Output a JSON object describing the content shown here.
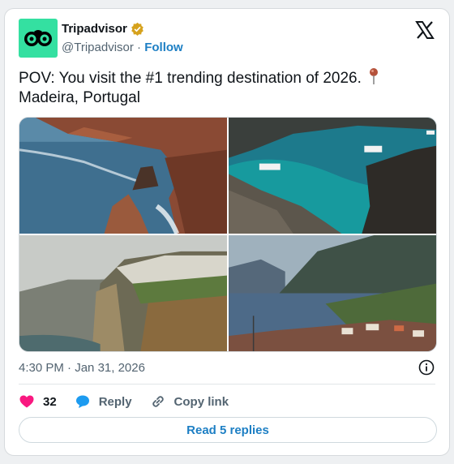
{
  "author": {
    "name": "Tripadvisor",
    "handle": "@Tripadvisor",
    "separator": "·",
    "follow_label": "Follow",
    "verified": true,
    "avatar_color": "#34e0a1"
  },
  "tweet": {
    "text_line1": "POV: You visit the #1 trending destination of 2026.",
    "text_line2": "Madeira, Portugal",
    "pin_icon": "round-pushpin-icon"
  },
  "media": [
    {
      "name": "cliffs-coast-photo"
    },
    {
      "name": "turquoise-bay-boats-photo"
    },
    {
      "name": "village-on-cliff-photo"
    },
    {
      "name": "coastal-town-valley-photo"
    }
  ],
  "meta": {
    "time": "4:30 PM",
    "separator": "·",
    "date": "Jan 31, 2026"
  },
  "actions": {
    "like_count": "32",
    "reply_label": "Reply",
    "copy_label": "Copy link"
  },
  "read_replies_label": "Read 5 replies",
  "colors": {
    "link": "#1d7fc4",
    "like": "#f91880",
    "muted": "#536471"
  }
}
